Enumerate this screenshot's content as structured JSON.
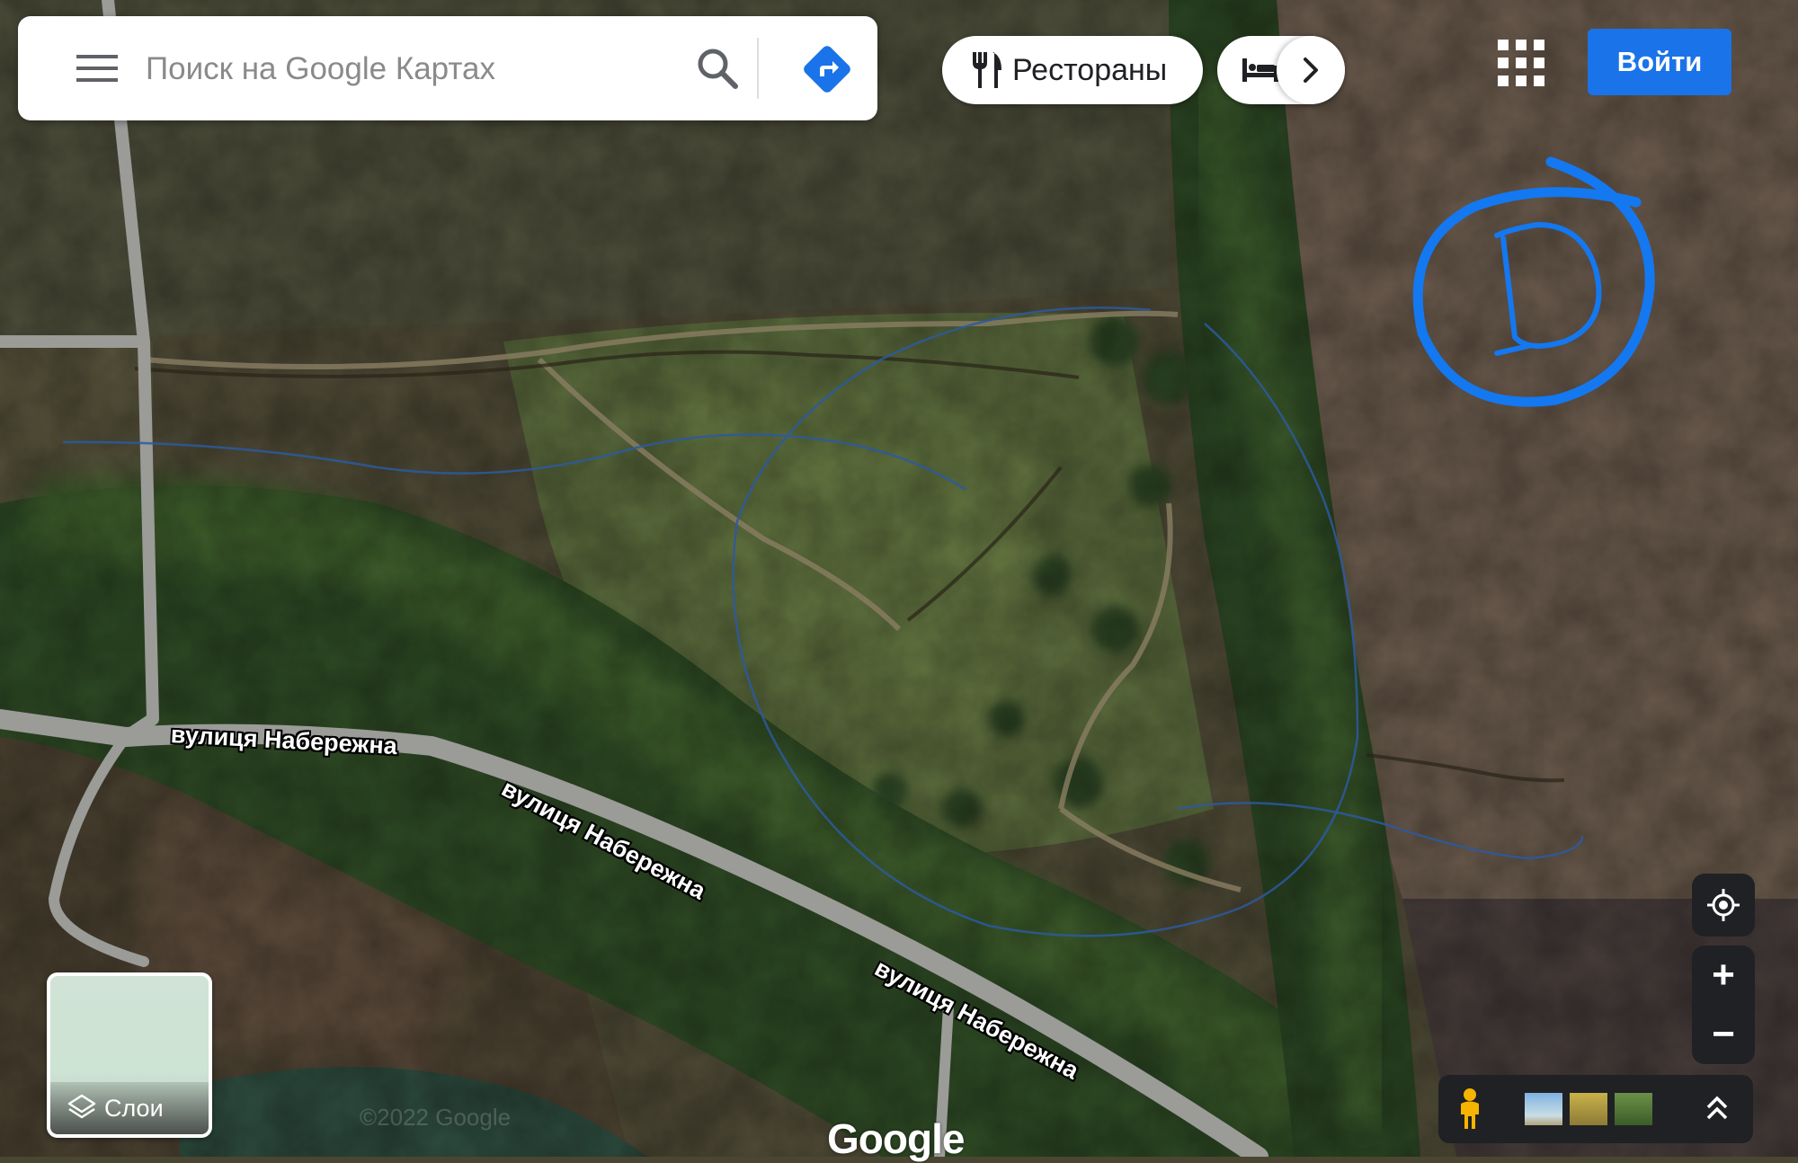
{
  "search": {
    "placeholder": "Поиск на Google Картах"
  },
  "icons": {
    "menu": "hamburger-menu-icon",
    "search": "search-icon",
    "directions": "directions-icon",
    "restaurants": "fork-knife-icon",
    "hotels": "bed-icon",
    "next": "chevron-right-icon",
    "apps": "apps-grid-icon",
    "location": "my-location-icon",
    "layers": "layers-icon",
    "pegman": "pegman-icon",
    "expand": "double-chevron-up-icon"
  },
  "chips": {
    "restaurants": "Рестораны"
  },
  "account": {
    "signin": "Войти"
  },
  "controls": {
    "zoom_in": "+",
    "zoom_out": "−"
  },
  "layers": {
    "label": "Слои"
  },
  "map": {
    "roads": [
      "вулиця Набережна",
      "вулиця Набережна",
      "вулиця Набережна"
    ],
    "annotation": "D",
    "logo": "Google",
    "watermark": "©2022 Google"
  },
  "colors": {
    "accent": "#1a73e8",
    "annotation": "#1478f0"
  }
}
